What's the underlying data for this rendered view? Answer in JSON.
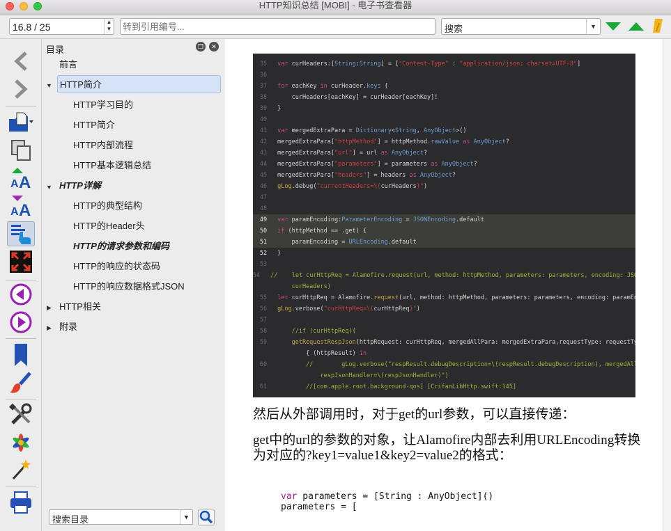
{
  "window": {
    "title": "HTTP知识总结 [MOBI] - 电子书查看器"
  },
  "toolbar": {
    "page_value": "16.8 / 25",
    "ref_placeholder": "转到引用编号...",
    "search_label": "搜索"
  },
  "sidebar_icons": [
    "back-icon",
    "forward-icon",
    "open-book-icon",
    "copy-icon",
    "font-larger-icon",
    "font-smaller-icon",
    "toc-icon",
    "fullscreen-icon",
    "previous-icon",
    "next-icon",
    "bookmark-icon",
    "theme-brush-icon",
    "tools-icon",
    "references-icon",
    "magic-wand-icon",
    "print-icon"
  ],
  "toc": {
    "title": "目录",
    "items": [
      {
        "label": "前言"
      },
      {
        "label": "HTTP简介"
      },
      {
        "label": "HTTP学习目的"
      },
      {
        "label": "HTTP简介"
      },
      {
        "label": "HTTP内部流程"
      },
      {
        "label": "HTTP基本逻辑总结"
      },
      {
        "label": "HTTP详解"
      },
      {
        "label": "HTTP的典型结构"
      },
      {
        "label": "HTTP的Header头"
      },
      {
        "label": "HTTP的请求参数和编码"
      },
      {
        "label": "HTTP的响应的状态码"
      },
      {
        "label": "HTTP的响应数据格式JSON"
      },
      {
        "label": "HTTP相关"
      },
      {
        "label": "附录"
      }
    ],
    "search_label": "搜索目录"
  },
  "content": {
    "code_lines": [
      {
        "n": "35",
        "parts": [
          [
            "kw",
            "var "
          ],
          [
            "",
            "curHeaders:["
          ],
          [
            "ty",
            "String"
          ],
          [
            "",
            ":"
          ],
          [
            "ty",
            "String"
          ],
          [
            "",
            "] = ["
          ],
          [
            "st",
            "\"Content-Type\""
          ],
          [
            "",
            " : "
          ],
          [
            "st",
            "\"application/json; charset=UTF-8\""
          ],
          [
            "",
            "]"
          ]
        ]
      },
      {
        "n": "36",
        "parts": []
      },
      {
        "n": "37",
        "parts": [
          [
            "kw",
            "for "
          ],
          [
            "",
            "eachKey "
          ],
          [
            "kw",
            "in "
          ],
          [
            "",
            "curHeader."
          ],
          [
            "ty",
            "keys"
          ],
          [
            "",
            " {"
          ]
        ]
      },
      {
        "n": "38",
        "parts": [
          [
            "",
            "    curHeaders[eachKey] = curHeader[eachKey]!"
          ]
        ]
      },
      {
        "n": "39",
        "parts": [
          [
            "",
            "}"
          ]
        ]
      },
      {
        "n": "40",
        "parts": []
      },
      {
        "n": "41",
        "parts": [
          [
            "kw",
            "var "
          ],
          [
            "",
            "mergedExtraPara = "
          ],
          [
            "ty",
            "Dictionary"
          ],
          [
            "",
            "<"
          ],
          [
            "ty",
            "String"
          ],
          [
            "",
            ", "
          ],
          [
            "ty",
            "AnyObject"
          ],
          [
            "",
            ">()"
          ]
        ]
      },
      {
        "n": "42",
        "parts": [
          [
            "",
            "mergedExtraPara["
          ],
          [
            "st",
            "\"httpMethod\""
          ],
          [
            "",
            "] = httpMethod."
          ],
          [
            "ty",
            "rawValue"
          ],
          [
            "",
            " "
          ],
          [
            "kw",
            "as "
          ],
          [
            "ty",
            "AnyObject"
          ],
          [
            "",
            "?"
          ]
        ]
      },
      {
        "n": "43",
        "parts": [
          [
            "",
            "mergedExtraPara["
          ],
          [
            "st",
            "\"url\""
          ],
          [
            "",
            "] = url "
          ],
          [
            "kw",
            "as "
          ],
          [
            "ty",
            "AnyObject"
          ],
          [
            "",
            "?"
          ]
        ]
      },
      {
        "n": "44",
        "parts": [
          [
            "",
            "mergedExtraPara["
          ],
          [
            "st",
            "\"parameters\""
          ],
          [
            "",
            "] = parameters "
          ],
          [
            "kw",
            "as "
          ],
          [
            "ty",
            "AnyObject"
          ],
          [
            "",
            "?"
          ]
        ]
      },
      {
        "n": "45",
        "parts": [
          [
            "",
            "mergedExtraPara["
          ],
          [
            "st",
            "\"headers\""
          ],
          [
            "",
            "] = headers "
          ],
          [
            "kw",
            "as "
          ],
          [
            "ty",
            "AnyObject"
          ],
          [
            "",
            "?"
          ]
        ]
      },
      {
        "n": "46",
        "parts": [
          [
            "fn",
            "gLog"
          ],
          [
            "",
            ".debug("
          ],
          [
            "st",
            "\"currentHeaders=\\("
          ],
          [
            "",
            "curHeaders"
          ],
          [
            "st",
            ")\""
          ],
          [
            "",
            ")"
          ]
        ]
      },
      {
        "n": "47",
        "parts": []
      },
      {
        "n": "48",
        "parts": []
      },
      {
        "n": "49",
        "parts": [
          [
            "kw",
            "var "
          ],
          [
            "",
            "paramEncoding:"
          ],
          [
            "ty",
            "ParameterEncoding"
          ],
          [
            "",
            " = "
          ],
          [
            "ty",
            "JSONEncoding"
          ],
          [
            "",
            ".default"
          ]
        ]
      },
      {
        "n": "50",
        "parts": [
          [
            "kw",
            "if "
          ],
          [
            "",
            "(httpMethod == .get) {"
          ]
        ]
      },
      {
        "n": "51",
        "parts": [
          [
            "",
            "    paramEncoding = "
          ],
          [
            "ty",
            "URLEncoding"
          ],
          [
            "",
            ".default"
          ]
        ]
      },
      {
        "n": "52",
        "parts": [
          [
            "",
            "}"
          ]
        ]
      },
      {
        "n": "53",
        "parts": []
      },
      {
        "n": "54",
        "parts": [
          [
            "cm",
            "//    let curHttpReq = Alamofire.request(url, method: httpMethod, parameters: parameters, encoding: JSONEncoding.default, headers:"
          ]
        ]
      },
      {
        "n": "",
        "parts": [
          [
            "cm",
            "    curHeaders)"
          ]
        ]
      },
      {
        "n": "55",
        "parts": [
          [
            "kw",
            "let "
          ],
          [
            "",
            "curHttpReq = Alamofire."
          ],
          [
            "fn",
            "request"
          ],
          [
            "",
            "(url, method: httpMethod, parameters: parameters, encoding: paramEncoding, headers: curHeaders"
          ]
        ]
      },
      {
        "n": "56",
        "parts": [
          [
            "fn",
            "gLog"
          ],
          [
            "",
            ".verbose("
          ],
          [
            "st",
            "\"curHttpReq=\\("
          ],
          [
            "",
            "curHttpReq"
          ],
          [
            "st",
            ")\""
          ],
          [
            "",
            ")"
          ]
        ]
      },
      {
        "n": "57",
        "parts": []
      },
      {
        "n": "58",
        "parts": [
          [
            "cm",
            "    //if (curHttpReq){"
          ]
        ]
      },
      {
        "n": "59",
        "parts": [
          [
            "fn",
            "    getRequestRespJson"
          ],
          [
            "",
            "(httpRequest: curHttpReq, mergedAllPara: mergedExtraPara,requestType: requestType, respJsonHandler:"
          ]
        ]
      },
      {
        "n": "",
        "parts": [
          [
            "",
            "        { (httpResult) "
          ],
          [
            "kw",
            "in"
          ]
        ]
      },
      {
        "n": "60",
        "parts": [
          [
            "cm",
            "        //        gLog.verbose(\"respResult.debugDescription=\\(respResult.debugDescription), mergedAllPara=\\(mergedAllPara),"
          ]
        ]
      },
      {
        "n": "",
        "parts": [
          [
            "cm",
            "            respJsonHandler=\\(respJsonHandler)\")"
          ]
        ]
      },
      {
        "n": "61",
        "parts": [
          [
            "cm",
            "        //[com.apple.root.background-qos] [CrifanLibHttp.swift:145]"
          ]
        ]
      }
    ],
    "para1": "然后从外部调用时，对于get的url参数，可以直接传递：",
    "para2": "get中的url的参数的对象，让Alamofire内部去利用URLEncoding转换为对应的?key1=value1&key2=value2的格式：",
    "snippet_kw": "var",
    "snippet_line1": " parameters = [String : AnyObject]()",
    "snippet_line2": "parameters = ["
  }
}
